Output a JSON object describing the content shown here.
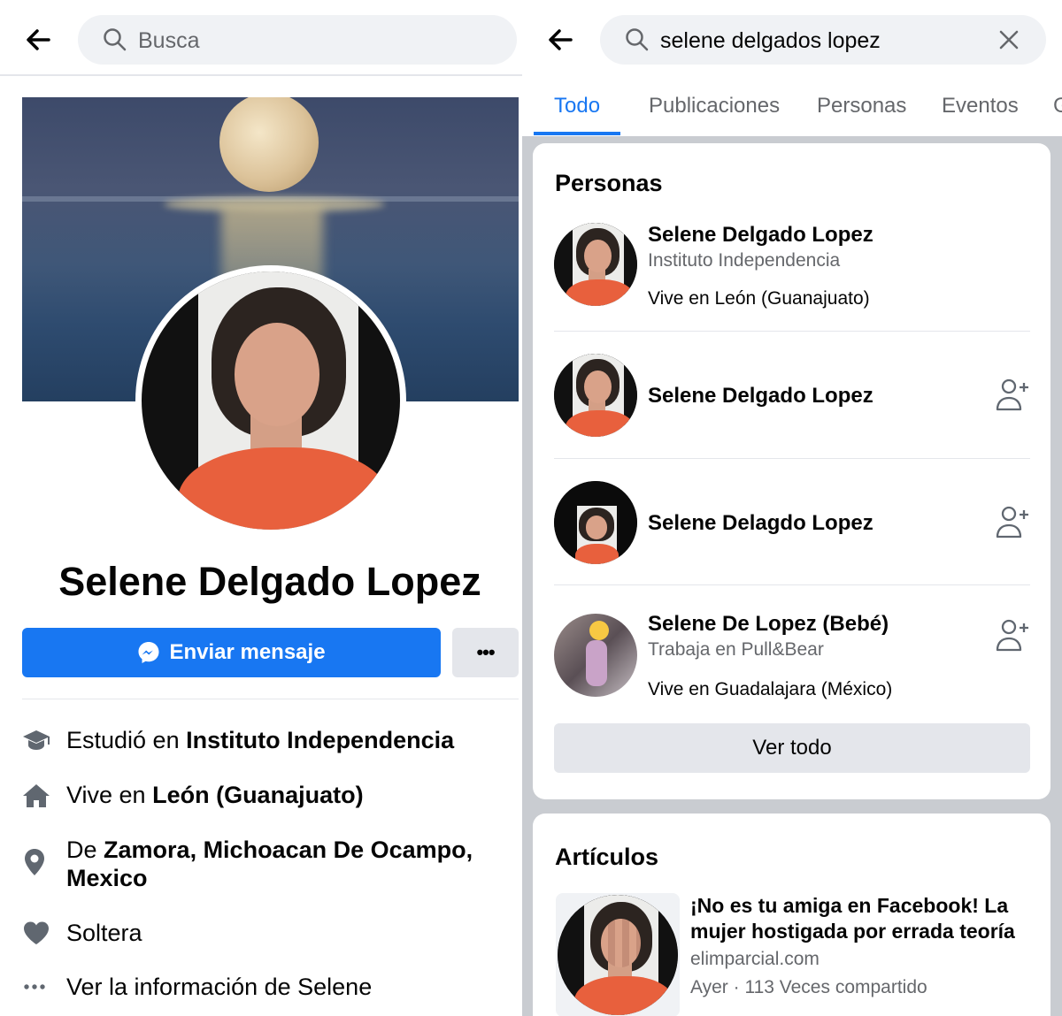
{
  "left": {
    "search_placeholder": "Busca",
    "profile_name": "Selene Delgado Lopez",
    "message_button": "Enviar mensaje",
    "more_button": "•••",
    "info": [
      {
        "icon": "graduation-cap-icon",
        "prefix": "Estudió en ",
        "bold": "Instituto Independencia"
      },
      {
        "icon": "home-icon",
        "prefix": "Vive en ",
        "bold": "León (Guanajuato)"
      },
      {
        "icon": "location-pin-icon",
        "prefix": "De ",
        "bold": "Zamora, Michoacan De Ocampo,",
        "bold2": "Mexico"
      },
      {
        "icon": "heart-icon",
        "prefix": "Soltera",
        "bold": ""
      },
      {
        "icon": "more-dots-icon",
        "prefix": "Ver la información de Selene",
        "bold": ""
      }
    ]
  },
  "right": {
    "search_value": "selene delgados lopez",
    "tabs": [
      "Todo",
      "Publicaciones",
      "Personas",
      "Eventos",
      "G"
    ],
    "people_title": "Personas",
    "people": [
      {
        "name": "Selene Delgado Lopez",
        "sub": "Instituto Independencia",
        "line": "Vive en León (Guanajuato)"
      },
      {
        "name": "Selene Delgado Lopez"
      },
      {
        "name": "Selene Delagdo Lopez"
      },
      {
        "name": "Selene De Lopez (Bebé)",
        "sub": "Trabaja en Pull&Bear",
        "line": "Vive en Guadalajara (México)"
      }
    ],
    "see_all": "Ver todo",
    "articles_title": "Artículos",
    "article": {
      "title": "¡No es tu amiga en Facebook! La mujer hostigada por errada teoría",
      "source": "elimparcial.com",
      "meta": "Ayer · 113 Veces compartido"
    }
  },
  "colors": {
    "accent": "#1877f2",
    "gray_text": "#65676b",
    "bg_gray": "#c9ccd1"
  }
}
